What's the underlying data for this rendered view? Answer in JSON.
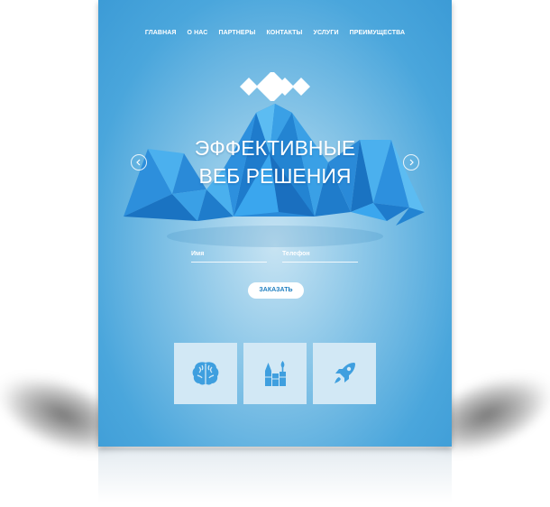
{
  "nav": {
    "items": [
      {
        "label": "ГЛАВНАЯ"
      },
      {
        "label": "О НАС"
      },
      {
        "label": "ПАРТНЕРЫ"
      },
      {
        "label": "КОНТАКТЫ"
      },
      {
        "label": "УСЛУГИ"
      },
      {
        "label": "ПРЕИМУЩЕСТВА"
      }
    ]
  },
  "hero": {
    "title_line1": "ЭФФЕКТИВНЫЕ",
    "title_line2": "ВЕБ РЕШЕНИЯ",
    "prev_icon": "chevron-left-icon",
    "next_icon": "chevron-right-icon"
  },
  "form": {
    "name_placeholder": "Имя",
    "phone_placeholder": "Телефон",
    "submit_label": "ЗАКАЗАТЬ"
  },
  "features": [
    {
      "icon": "brain-icon"
    },
    {
      "icon": "art-supplies-icon"
    },
    {
      "icon": "rocket-icon"
    }
  ],
  "colors": {
    "background_top": "#3c9bd6",
    "background_center": "#c8e4f3",
    "mountain_dark": "#1a78c8",
    "mountain_light": "#3fa7ea",
    "tile": "#d2e8f5",
    "tile_icon": "#3f9fdf",
    "button_text": "#1f7fc0"
  }
}
